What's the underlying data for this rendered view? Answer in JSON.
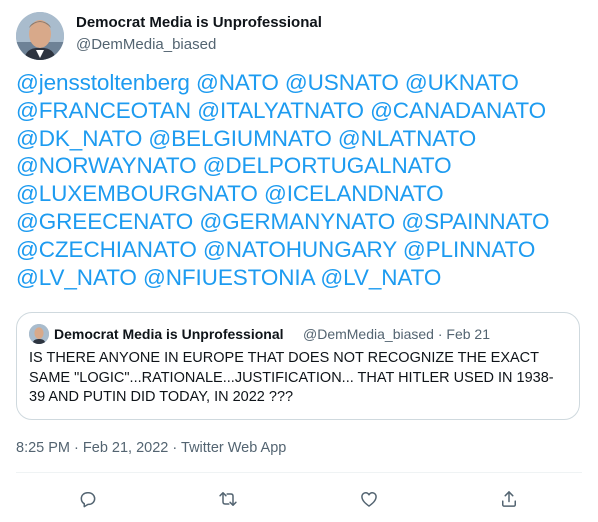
{
  "author": {
    "name": "Democrat Media is Unprofessional",
    "handle": "@DemMedia_biased"
  },
  "body": {
    "mentions": [
      "@jensstoltenberg",
      "@NATO",
      "@USNATO",
      "@UKNATO",
      "@FRANCEOTAN",
      "@ITALYATNATO",
      "@CANADANATO",
      "@DK_NATO",
      "@BELGIUMNATO",
      "@NLATNATO",
      "@NORWAYNATO",
      "@DELPORTUGALNATO",
      "@LUXEMBOURGNATO",
      "@ICELANDNATO",
      "@GREECENATO",
      "@GERMANYNATO",
      "@SPAINNATO",
      "@CZECHIANATO",
      "@NATOHUNGARY",
      "@PLINNATO",
      "@LV_NATO",
      "@NFIUESTONIA",
      "@LV_NATO"
    ]
  },
  "quote": {
    "name": "Democrat Media is Unprofessional",
    "handle": "@DemMedia_biased",
    "separator": "·",
    "date": "Feb 21",
    "text": "IS THERE ANYONE IN EUROPE THAT DOES NOT RECOGNIZE THE EXACT SAME \"LOGIC\"...RATIONALE...JUSTIFICATION... THAT HITLER USED IN 1938-39 AND PUTIN DID TODAY, IN 2022 ???"
  },
  "meta": {
    "time": "8:25 PM",
    "separator": "·",
    "date": "Feb 21, 2022",
    "app": "Twitter Web App"
  },
  "actions": {
    "reply_icon": "reply-icon",
    "retweet_icon": "retweet-icon",
    "like_icon": "heart-icon",
    "share_icon": "share-icon"
  },
  "colors": {
    "link": "#1d9bf0",
    "text": "#0f1419",
    "secondary": "#536471",
    "border": "#cfd9de"
  }
}
